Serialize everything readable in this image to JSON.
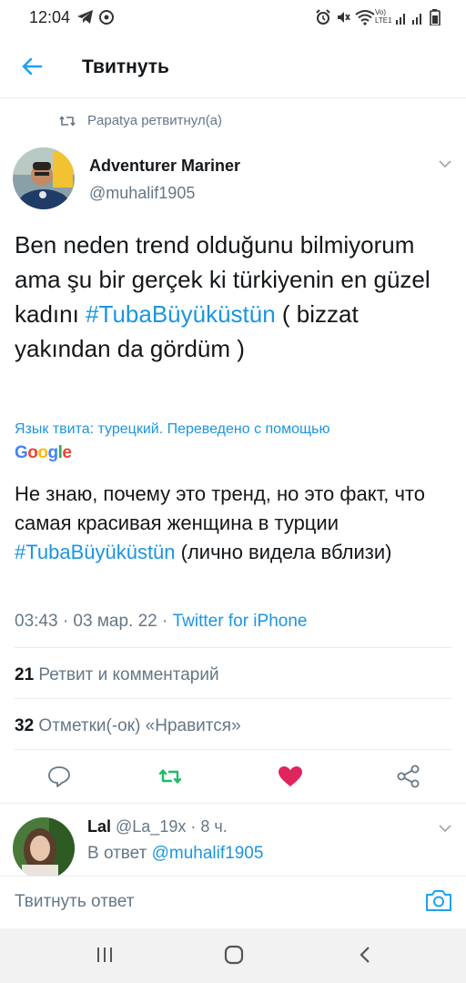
{
  "status_bar": {
    "time": "12:04",
    "network_label": "Vo) LTE1"
  },
  "header": {
    "title": "Твитнуть"
  },
  "retweet": {
    "label": "Papatya ретвитнул(а)"
  },
  "tweet": {
    "author_name": "Adventurer Mariner",
    "author_handle": "@muhalif1905",
    "text_before": "Ben neden trend olduğunu bilmiyorum ama şu bir gerçek ki türkiyenin en güzel kadını ",
    "hashtag": "#TubaBüyüküstün",
    "text_after": " ( bizzat yakından da gördüm )",
    "translation_info": "Язык твита: турецкий. Переведено с помощью",
    "translation_provider": "Google",
    "translated_before": "Не знаю, почему это тренд, но это факт, что самая красивая женщина в турции ",
    "translated_hashtag": "#TubaBüyüküstün",
    "translated_after": " (лично видела вблизи)",
    "time": "03:43 · 03 мар. 22 · ",
    "source": "Twitter for iPhone",
    "retweets_count": "21",
    "retweets_label": "Ретвит и комментарий",
    "likes_count": "32",
    "likes_label": "Отметки(-ок) «Нравится»",
    "liked": true
  },
  "reply": {
    "author_name": "Lal",
    "author_meta": " @La_19x · 8 ч.",
    "reply_prefix": "В ответ ",
    "reply_handle": "@muhalif1905"
  },
  "compose": {
    "placeholder": "Твитнуть ответ"
  },
  "colors": {
    "accent": "#1da1f2",
    "retweet_green": "#17bf63",
    "like_red": "#e0245e",
    "muted": "#657786"
  },
  "icons": {
    "back": "arrow-left-icon",
    "retweet": "retweet-icon",
    "reply": "comment-icon",
    "like": "heart-icon",
    "share": "share-icon",
    "camera": "camera-icon"
  }
}
